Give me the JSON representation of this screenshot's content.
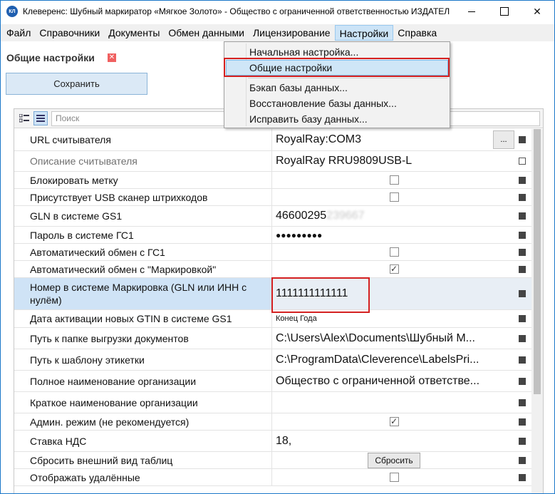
{
  "window": {
    "title": "Клеверенс: Шубный маркиратор «Мягкое Золото» - Общество с ограниченной ответственностью ИЗДАТЕЛ...",
    "app_icon_text": "КЛ"
  },
  "menu": {
    "items": [
      "Файл",
      "Справочники",
      "Документы",
      "Обмен данными",
      "Лицензирование",
      "Настройки",
      "Справка"
    ],
    "active": "Настройки"
  },
  "dropdown": {
    "items": [
      "Начальная настройка...",
      "Общие настройки",
      "Бэкап базы данных...",
      "Восстановление базы данных...",
      "Исправить базу данных..."
    ],
    "highlighted": "Общие настройки"
  },
  "page": {
    "title": "Общие настройки",
    "close_symbol": "✕",
    "save_label": "Сохранить"
  },
  "grid": {
    "search_placeholder": "Поиск",
    "rows": [
      {
        "name": "URL считывателя",
        "value": "RoyalRay:COM3",
        "type": "text-button",
        "button": "..."
      },
      {
        "name": "Описание считывателя",
        "value": "RoyalRay RRU9809USB-L",
        "type": "text",
        "muted": true
      },
      {
        "name": "Блокировать метку",
        "type": "checkbox",
        "checked": false
      },
      {
        "name": "Присутствует USB сканер штрихкодов",
        "type": "checkbox",
        "checked": false
      },
      {
        "name": "GLN в системе GS1",
        "value": "46600295",
        "value_blurred": "239667",
        "type": "text"
      },
      {
        "name": "Пароль в системе ГС1",
        "value": "●●●●●●●●●",
        "type": "password"
      },
      {
        "name": "Автоматический обмен с ГС1",
        "type": "checkbox",
        "checked": false
      },
      {
        "name": "Автоматический обмен с \"Маркировкой\"",
        "type": "checkbox",
        "checked": true
      },
      {
        "name": "Номер в системе Маркировка (GLN или ИНН с нулём)",
        "value": "1111111111111",
        "type": "text",
        "selected": true
      },
      {
        "name": "Дата активации новых GTIN в системе GS1",
        "value": "Конец Года",
        "type": "small"
      },
      {
        "name": "Путь к папке выгрузки документов",
        "value": "C:\\Users\\Alex\\Documents\\Шубный  М...",
        "type": "text"
      },
      {
        "name": "Путь к шаблону этикетки",
        "value": "C:\\ProgramData\\Cleverence\\LabelsPri...",
        "type": "text"
      },
      {
        "name": "Полное наименование организации",
        "value": "Общество с ограниченной ответстве...",
        "type": "text"
      },
      {
        "name": "Краткое наименование организации",
        "value": "",
        "type": "text"
      },
      {
        "name": "Админ. режим (не рекомендуется)",
        "type": "checkbox",
        "checked": true
      },
      {
        "name": "Ставка НДС",
        "value": "18,",
        "type": "text"
      },
      {
        "name": "Сбросить внешний вид таблиц",
        "type": "button",
        "button": "Сбросить"
      },
      {
        "name": "Отображать удалённые",
        "type": "checkbox",
        "checked": false
      }
    ]
  },
  "colors": {
    "menu_highlight": "#cce4f7",
    "selected_row": "#cfe3f6",
    "annotation_red": "#d42020"
  }
}
